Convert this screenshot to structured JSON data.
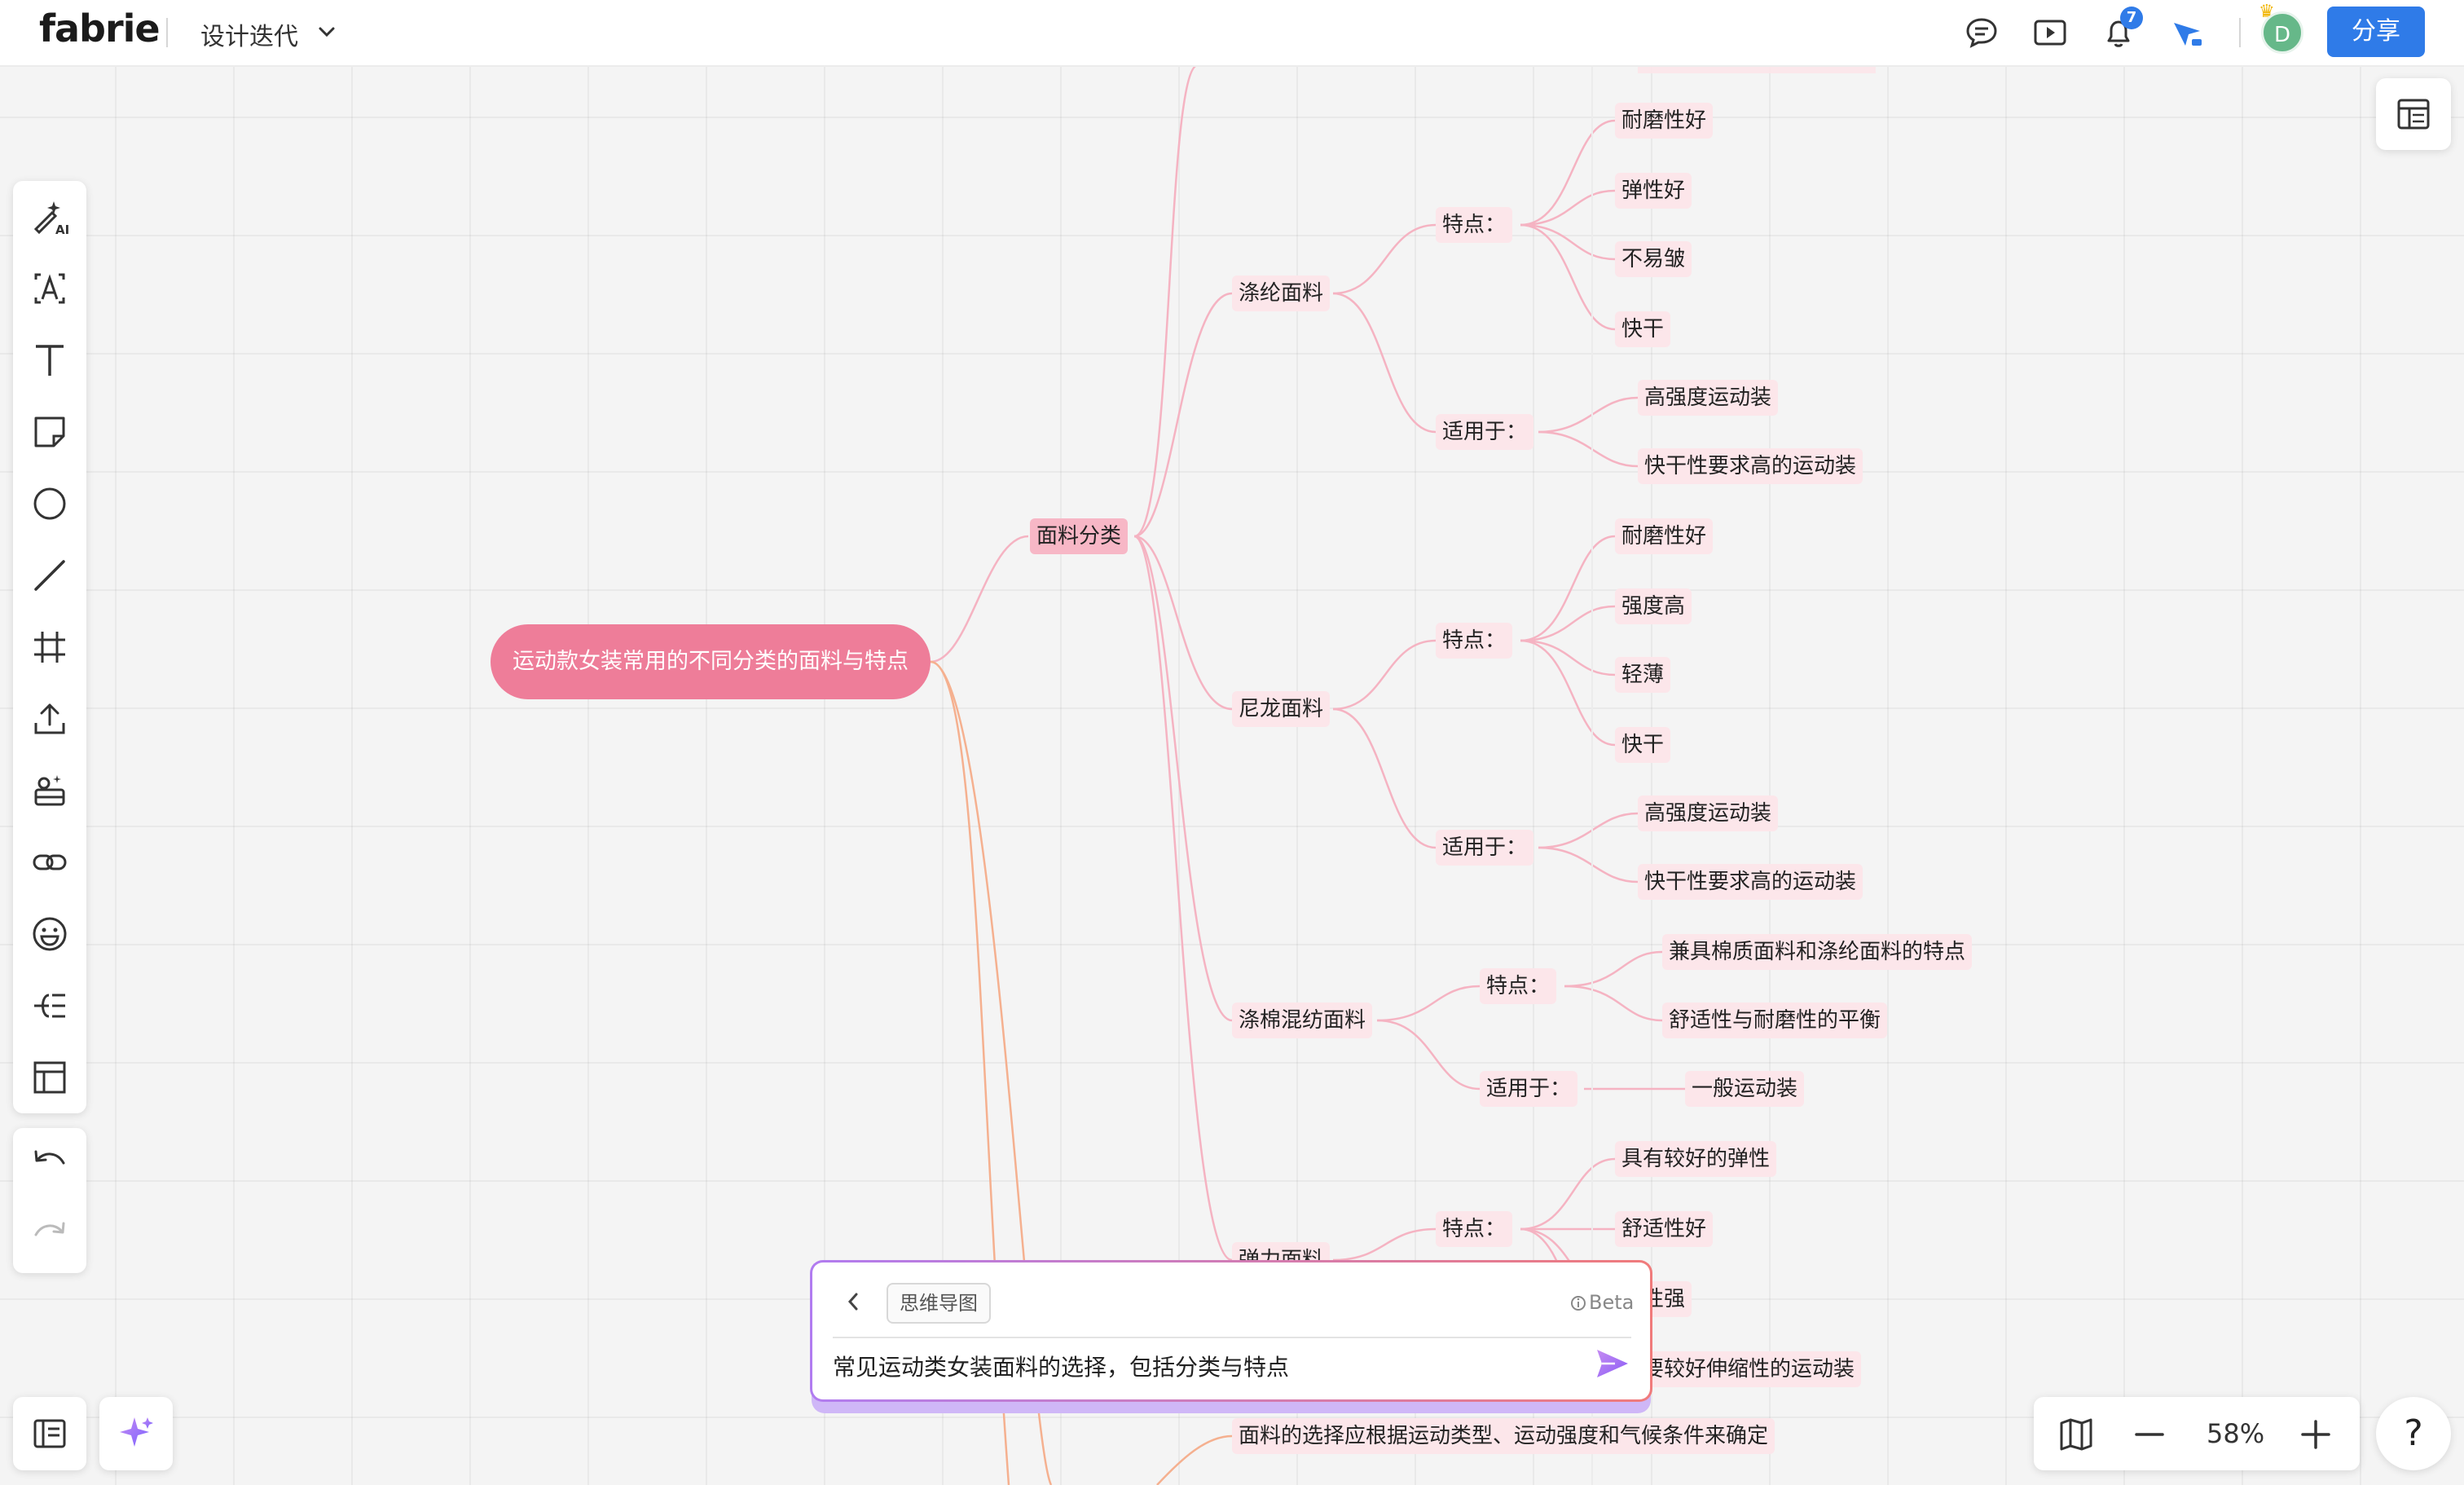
{
  "app": {
    "logo": "fabrie",
    "doc_title": "设计迭代",
    "share_label": "分享",
    "notification_count": "7",
    "avatar_initial": "D"
  },
  "topbar_icons": [
    "comment-icon",
    "present-icon",
    "bell-icon",
    "cursor-icon"
  ],
  "toolbar": {
    "tools": [
      "ai-magic-icon",
      "text-frame-icon",
      "text-icon",
      "sticky-note-icon",
      "shape-circle-icon",
      "line-icon",
      "frame-icon",
      "upload-icon",
      "template-icon",
      "link-icon",
      "emoji-icon",
      "mindmap-icon",
      "table-icon"
    ],
    "history": [
      "undo-icon",
      "redo-icon"
    ]
  },
  "mindmap": {
    "root": "运动款女装常用的不同分类的面料与特点",
    "category": "面料分类",
    "fabrics": [
      {
        "name": "涤纶面料",
        "features_label": "特点：",
        "features": [
          "耐磨性好",
          "弹性好",
          "不易皱",
          "快干"
        ],
        "usage_label": "适用于：",
        "usages": [
          "高强度运动装",
          "快干性要求高的运动装"
        ]
      },
      {
        "name": "尼龙面料",
        "features_label": "特点：",
        "features": [
          "耐磨性好",
          "强度高",
          "轻薄",
          "快干"
        ],
        "usage_label": "适用于：",
        "usages": [
          "高强度运动装",
          "快干性要求高的运动装"
        ]
      },
      {
        "name": "涤棉混纺面料",
        "features_label": "特点：",
        "features": [
          "兼具棉质面料和涤纶面料的特点",
          "舒适性与耐磨性的平衡"
        ],
        "usage_label": "适用于：",
        "usages": [
          "一般运动装"
        ]
      },
      {
        "name": "弹力面料",
        "features_label": "特点：",
        "features": [
          "具有较好的弹性",
          "舒适性好",
          "显性强"
        ],
        "usage_label": "",
        "usages": [
          "需要较好伸缩性的运动装"
        ]
      }
    ],
    "conclusion": "面料的选择应根据运动类型、运动强度和气候条件来确定"
  },
  "ai_panel": {
    "mode_tag": "思维导图",
    "beta": "Beta",
    "input_value": "常见运动类女装面料的选择，包括分类与特点"
  },
  "zoom": {
    "level": "58%"
  },
  "help_label": "?",
  "colors": {
    "root": "#ee7d99",
    "branch": "#f7b7c6",
    "leaf": "#fce6ea",
    "accent": "#2f7be8"
  }
}
